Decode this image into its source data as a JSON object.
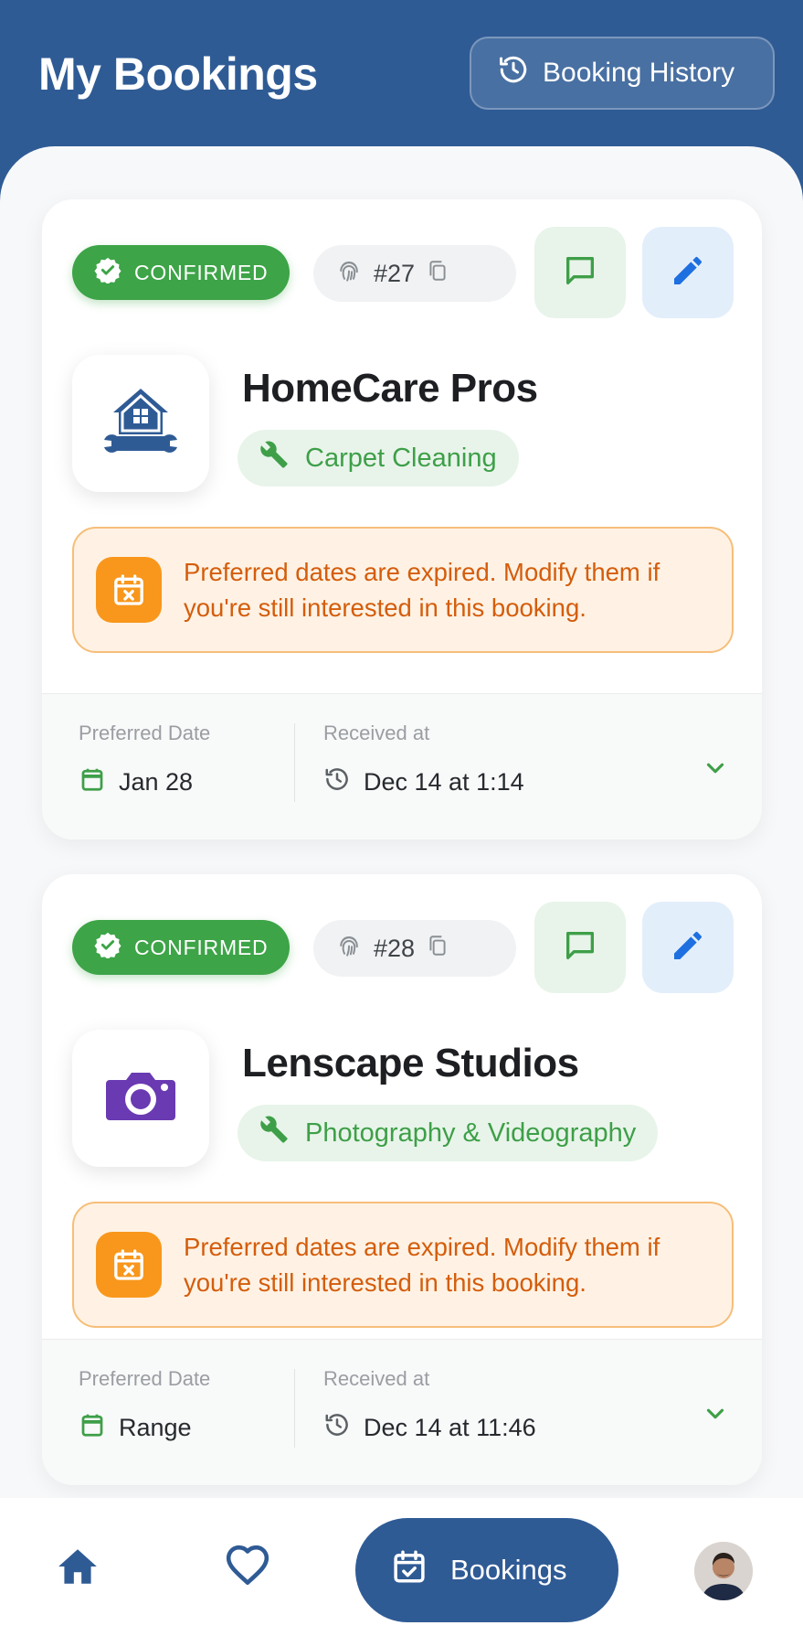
{
  "header": {
    "title": "My Bookings",
    "history_button": "Booking History"
  },
  "bookings": [
    {
      "status": "CONFIRMED",
      "id": "#27",
      "company": "HomeCare Pros",
      "logo_icon": "house-wrench-icon",
      "category": "Carpet Cleaning",
      "warning": "Preferred dates are expired. Modify them if you're still interested in this booking.",
      "preferred_date_label": "Preferred Date",
      "preferred_date": "Jan 28",
      "received_label": "Received at",
      "received_at": "Dec 14 at 1:14"
    },
    {
      "status": "CONFIRMED",
      "id": "#28",
      "company": "Lenscape Studios",
      "logo_icon": "camera-icon",
      "category": "Photography & Videography",
      "warning": "Preferred dates are expired. Modify them if you're still interested in this booking.",
      "preferred_date_label": "Preferred Date",
      "preferred_date": "Range",
      "received_label": "Received at",
      "received_at": "Dec 14 at 11:46"
    }
  ],
  "nav": {
    "active_label": "Bookings",
    "items": [
      "home-icon",
      "heart-icon",
      "calendar-check-icon",
      "avatar"
    ]
  },
  "colors": {
    "primary": "#2f5b95",
    "success": "#3da447",
    "warning_bg": "#fff2e4",
    "warning_text": "#d45d0c",
    "warning_icon": "#f8971c"
  }
}
